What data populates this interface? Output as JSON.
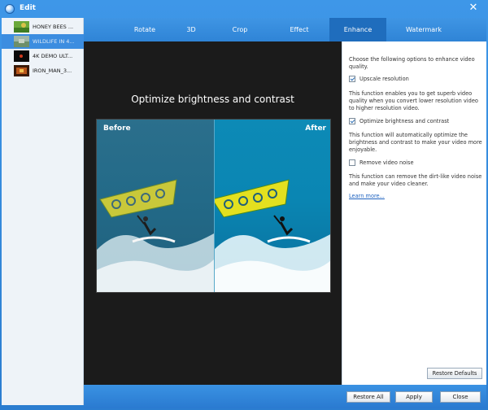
{
  "window": {
    "title": "Edit"
  },
  "files": [
    {
      "name": "HONEY BEES ..."
    },
    {
      "name": "WILDLIFE IN 4..."
    },
    {
      "name": "4K DEMO ULT..."
    },
    {
      "name": "IRON_MAN_3..."
    }
  ],
  "tabs": [
    {
      "label": "Rotate"
    },
    {
      "label": "3D"
    },
    {
      "label": "Crop"
    },
    {
      "label": "Effect"
    },
    {
      "label": "Enhance"
    },
    {
      "label": "Watermark"
    }
  ],
  "preview": {
    "title": "Optimize brightness and contrast",
    "before_label": "Before",
    "after_label": "After"
  },
  "enhance": {
    "intro": "Choose the following options to enhance video quality.",
    "options": [
      {
        "label": "Upscale resolution",
        "checked": true,
        "description": "This function enables you to get superb video quality when you convert lower resolution video to higher resolution video."
      },
      {
        "label": "Optimize brightness and contrast",
        "checked": true,
        "description": "This function will automatically optimize the brightness and contrast to make your video more enjoyable."
      },
      {
        "label": "Remove video noise",
        "checked": false,
        "description": "This function can remove the dirt-like video noise and make your video cleaner."
      }
    ],
    "learn_more": "Learn more...",
    "restore_defaults": "Restore Defaults"
  },
  "footer": {
    "restore_all": "Restore All",
    "apply": "Apply",
    "close": "Close"
  },
  "colors": {
    "accent": "#2f84d6",
    "active_tab": "#1f6dbd",
    "selected_item": "#3c8de0",
    "preview_bg": "#1b1b1b",
    "link": "#1f63c0"
  },
  "icons": [
    "app-icon",
    "close-icon",
    "checkbox-checked-icon",
    "checkbox-unchecked-icon"
  ]
}
